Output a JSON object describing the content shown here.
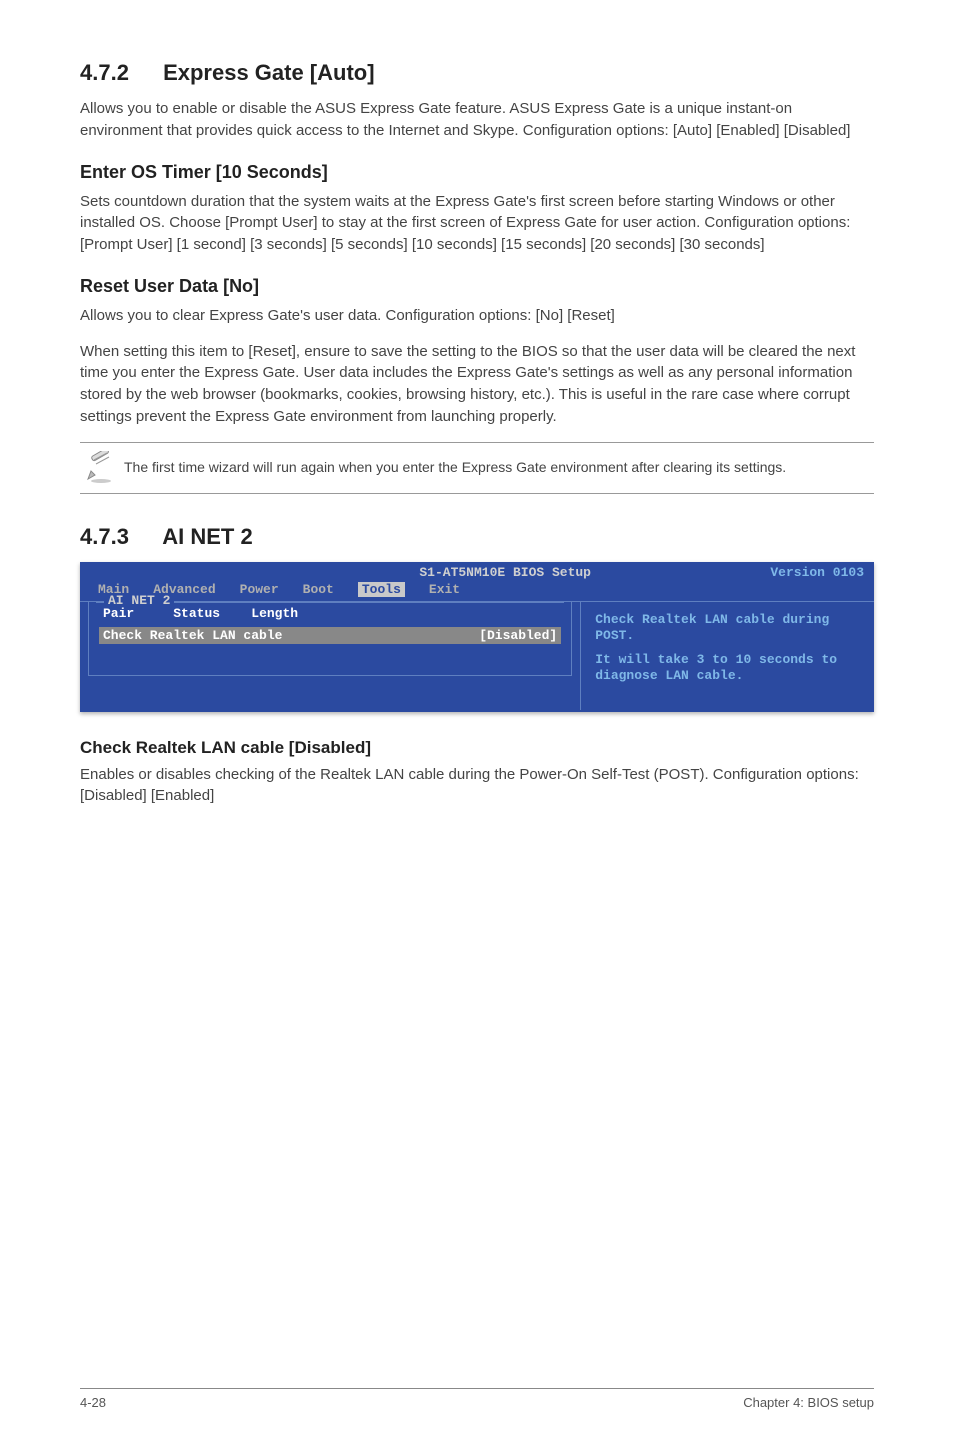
{
  "s472": {
    "heading_num": "4.7.2",
    "heading_title": "Express Gate [Auto]",
    "intro": "Allows you to enable or disable the ASUS Express Gate feature. ASUS Express Gate is a unique instant-on environment that provides quick access to the Internet and Skype. Configuration options: [Auto] [Enabled] [Disabled]",
    "sub1_title": "Enter OS Timer [10 Seconds]",
    "sub1_text": "Sets countdown duration that the system waits at the Express Gate's first screen before starting Windows or other installed OS. Choose [Prompt User] to stay at the first screen of Express Gate for user action. Configuration options: [Prompt User] [1 second] [3 seconds] [5 seconds] [10 seconds] [15 seconds] [20 seconds] [30 seconds]",
    "sub2_title": "Reset User Data [No]",
    "sub2_text1": "Allows you to clear Express Gate's user data. Configuration options: [No] [Reset]",
    "sub2_text2": "When setting this item to [Reset], ensure to save the setting to the BIOS so that the user data will be cleared the next time you enter the Express Gate. User data includes the Express Gate's settings as well as any personal information stored by the web browser (bookmarks, cookies, browsing history, etc.). This is useful in the rare case where corrupt settings prevent the Express Gate environment from launching properly.",
    "note": "The first time wizard will run again when you enter the Express Gate environment after clearing its settings."
  },
  "s473": {
    "heading_num": "4.7.3",
    "heading_title": "AI NET 2",
    "bios": {
      "title": "S1-AT5NM10E BIOS Setup",
      "version": "Version 0103",
      "menu": [
        "Main",
        "Advanced",
        "Power",
        "Boot",
        "Tools",
        "Exit"
      ],
      "box_label": "AI NET 2",
      "head_pair": "Pair",
      "head_status": "Status",
      "head_length": "Length",
      "row_label": "Check Realtek LAN cable",
      "row_value": "[Disabled]",
      "help1": "Check Realtek LAN cable during POST.",
      "help2": "It will take 3 to 10 seconds to diagnose LAN cable."
    },
    "sub1_title": "Check Realtek LAN cable [Disabled]",
    "sub1_text": "Enables or disables checking of the Realtek LAN cable during the Power-On Self-Test (POST). Configuration options: [Disabled] [Enabled]"
  },
  "footer": {
    "left": "4-28",
    "right": "Chapter 4: BIOS setup"
  }
}
